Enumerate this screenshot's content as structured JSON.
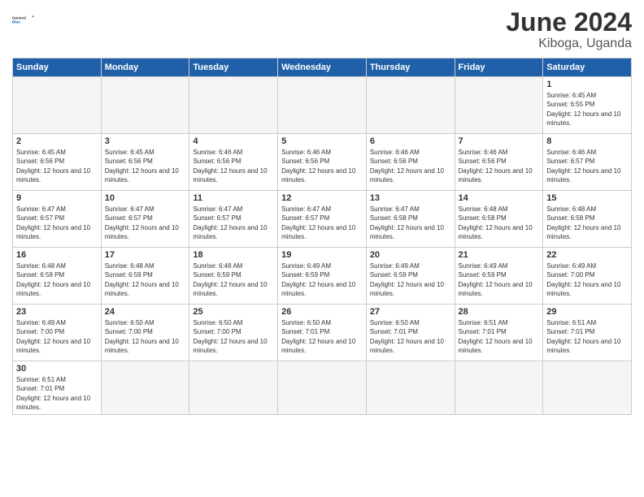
{
  "header": {
    "logo_general": "General",
    "logo_blue": "Blue",
    "month": "June 2024",
    "location": "Kiboga, Uganda"
  },
  "days_of_week": [
    "Sunday",
    "Monday",
    "Tuesday",
    "Wednesday",
    "Thursday",
    "Friday",
    "Saturday"
  ],
  "weeks": [
    [
      {
        "day": "",
        "empty": true
      },
      {
        "day": "",
        "empty": true
      },
      {
        "day": "",
        "empty": true
      },
      {
        "day": "",
        "empty": true
      },
      {
        "day": "",
        "empty": true
      },
      {
        "day": "",
        "empty": true
      },
      {
        "day": "1",
        "sunrise": "6:45 AM",
        "sunset": "6:55 PM",
        "daylight": "12 hours and 10 minutes."
      }
    ],
    [
      {
        "day": "2",
        "sunrise": "6:45 AM",
        "sunset": "6:56 PM",
        "daylight": "12 hours and 10 minutes."
      },
      {
        "day": "3",
        "sunrise": "6:45 AM",
        "sunset": "6:56 PM",
        "daylight": "12 hours and 10 minutes."
      },
      {
        "day": "4",
        "sunrise": "6:46 AM",
        "sunset": "6:56 PM",
        "daylight": "12 hours and 10 minutes."
      },
      {
        "day": "5",
        "sunrise": "6:46 AM",
        "sunset": "6:56 PM",
        "daylight": "12 hours and 10 minutes."
      },
      {
        "day": "6",
        "sunrise": "6:46 AM",
        "sunset": "6:56 PM",
        "daylight": "12 hours and 10 minutes."
      },
      {
        "day": "7",
        "sunrise": "6:46 AM",
        "sunset": "6:56 PM",
        "daylight": "12 hours and 10 minutes."
      },
      {
        "day": "8",
        "sunrise": "6:46 AM",
        "sunset": "6:57 PM",
        "daylight": "12 hours and 10 minutes."
      }
    ],
    [
      {
        "day": "9",
        "sunrise": "6:47 AM",
        "sunset": "6:57 PM",
        "daylight": "12 hours and 10 minutes."
      },
      {
        "day": "10",
        "sunrise": "6:47 AM",
        "sunset": "6:57 PM",
        "daylight": "12 hours and 10 minutes."
      },
      {
        "day": "11",
        "sunrise": "6:47 AM",
        "sunset": "6:57 PM",
        "daylight": "12 hours and 10 minutes."
      },
      {
        "day": "12",
        "sunrise": "6:47 AM",
        "sunset": "6:57 PM",
        "daylight": "12 hours and 10 minutes."
      },
      {
        "day": "13",
        "sunrise": "6:47 AM",
        "sunset": "6:58 PM",
        "daylight": "12 hours and 10 minutes."
      },
      {
        "day": "14",
        "sunrise": "6:48 AM",
        "sunset": "6:58 PM",
        "daylight": "12 hours and 10 minutes."
      },
      {
        "day": "15",
        "sunrise": "6:48 AM",
        "sunset": "6:58 PM",
        "daylight": "12 hours and 10 minutes."
      }
    ],
    [
      {
        "day": "16",
        "sunrise": "6:48 AM",
        "sunset": "6:58 PM",
        "daylight": "12 hours and 10 minutes."
      },
      {
        "day": "17",
        "sunrise": "6:48 AM",
        "sunset": "6:59 PM",
        "daylight": "12 hours and 10 minutes."
      },
      {
        "day": "18",
        "sunrise": "6:48 AM",
        "sunset": "6:59 PM",
        "daylight": "12 hours and 10 minutes."
      },
      {
        "day": "19",
        "sunrise": "6:49 AM",
        "sunset": "6:59 PM",
        "daylight": "12 hours and 10 minutes."
      },
      {
        "day": "20",
        "sunrise": "6:49 AM",
        "sunset": "6:59 PM",
        "daylight": "12 hours and 10 minutes."
      },
      {
        "day": "21",
        "sunrise": "6:49 AM",
        "sunset": "6:59 PM",
        "daylight": "12 hours and 10 minutes."
      },
      {
        "day": "22",
        "sunrise": "6:49 AM",
        "sunset": "7:00 PM",
        "daylight": "12 hours and 10 minutes."
      }
    ],
    [
      {
        "day": "23",
        "sunrise": "6:49 AM",
        "sunset": "7:00 PM",
        "daylight": "12 hours and 10 minutes."
      },
      {
        "day": "24",
        "sunrise": "6:50 AM",
        "sunset": "7:00 PM",
        "daylight": "12 hours and 10 minutes."
      },
      {
        "day": "25",
        "sunrise": "6:50 AM",
        "sunset": "7:00 PM",
        "daylight": "12 hours and 10 minutes."
      },
      {
        "day": "26",
        "sunrise": "6:50 AM",
        "sunset": "7:01 PM",
        "daylight": "12 hours and 10 minutes."
      },
      {
        "day": "27",
        "sunrise": "6:50 AM",
        "sunset": "7:01 PM",
        "daylight": "12 hours and 10 minutes."
      },
      {
        "day": "28",
        "sunrise": "6:51 AM",
        "sunset": "7:01 PM",
        "daylight": "12 hours and 10 minutes."
      },
      {
        "day": "29",
        "sunrise": "6:51 AM",
        "sunset": "7:01 PM",
        "daylight": "12 hours and 10 minutes."
      }
    ],
    [
      {
        "day": "30",
        "sunrise": "6:51 AM",
        "sunset": "7:01 PM",
        "daylight": "12 hours and 10 minutes."
      },
      {
        "day": "",
        "empty": true
      },
      {
        "day": "",
        "empty": true
      },
      {
        "day": "",
        "empty": true
      },
      {
        "day": "",
        "empty": true
      },
      {
        "day": "",
        "empty": true
      },
      {
        "day": "",
        "empty": true
      }
    ]
  ]
}
